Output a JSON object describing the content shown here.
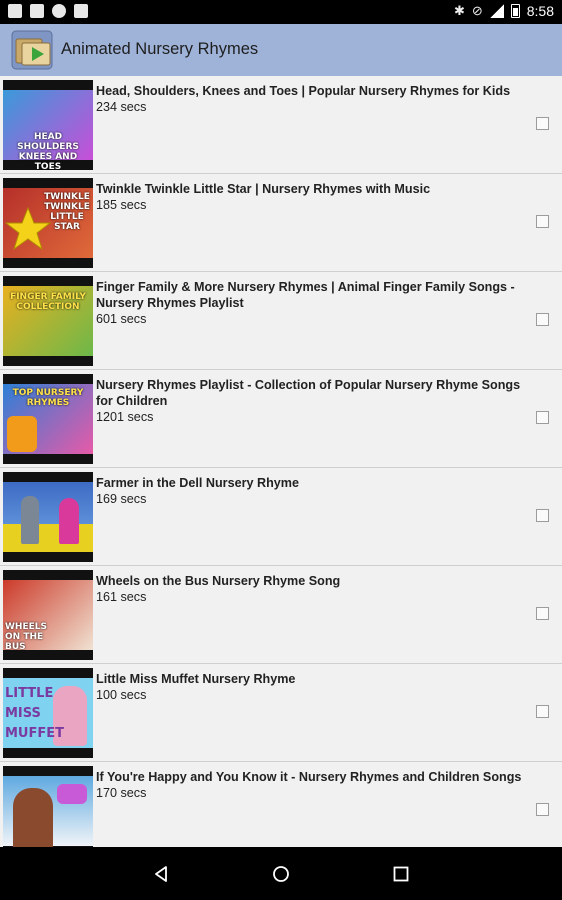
{
  "status_bar": {
    "time": "8:58",
    "left_icons": [
      "image-icon",
      "mail-icon",
      "bug-icon",
      "bag-icon"
    ],
    "right_icons": [
      "bluetooth-icon",
      "do-not-disturb-icon",
      "signal-icon",
      "battery-icon"
    ]
  },
  "app_bar": {
    "title": "Animated Nursery Rhymes",
    "color": "#9fb3d9"
  },
  "videos": [
    {
      "title": "Head, Shoulders, Knees and Toes | Popular Nursery Rhymes for Kids",
      "duration": "234 secs",
      "thumb_caption": "HEAD SHOULDERS KNEES AND TOES",
      "thumb_color": "#3a9ad9"
    },
    {
      "title": "Twinkle Twinkle Little Star | Nursery Rhymes with Music",
      "duration": "185 secs",
      "thumb_caption": "TWINKLE TWINKLE LITTLE STAR",
      "thumb_color": "#b5302a"
    },
    {
      "title": "Finger Family & More Nursery Rhymes | Animal Finger Family Songs - Nursery Rhymes Playlist",
      "duration": "601 secs",
      "thumb_caption": "FINGER FAMILY COLLECTION",
      "thumb_color": "#e8b020"
    },
    {
      "title": "Nursery Rhymes Playlist - Collection of Popular Nursery Rhyme Songs for Children",
      "duration": "1201 secs",
      "thumb_caption": "TOP NURSERY RHYMES",
      "thumb_color": "#2c7fd6"
    },
    {
      "title": "Farmer in the Dell Nursery Rhyme",
      "duration": "169 secs",
      "thumb_caption": "",
      "thumb_color": "#3d6bc4"
    },
    {
      "title": "Wheels on the Bus Nursery Rhyme Song",
      "duration": "161 secs",
      "thumb_caption": "WHEELS ON THE BUS",
      "thumb_color": "#cc3a2a"
    },
    {
      "title": "Little Miss Muffet Nursery Rhyme",
      "duration": "100 secs",
      "thumb_caption": "LITTLE MISS MUFFET",
      "thumb_color": "#7fd3f0"
    },
    {
      "title": "If You're Happy and You Know it - Nursery Rhymes and Children Songs",
      "duration": "170 secs",
      "thumb_caption": "",
      "thumb_color": "#5fa9e0"
    }
  ],
  "nav_bar": {
    "icons": [
      "back-icon",
      "home-icon",
      "recents-icon"
    ]
  }
}
